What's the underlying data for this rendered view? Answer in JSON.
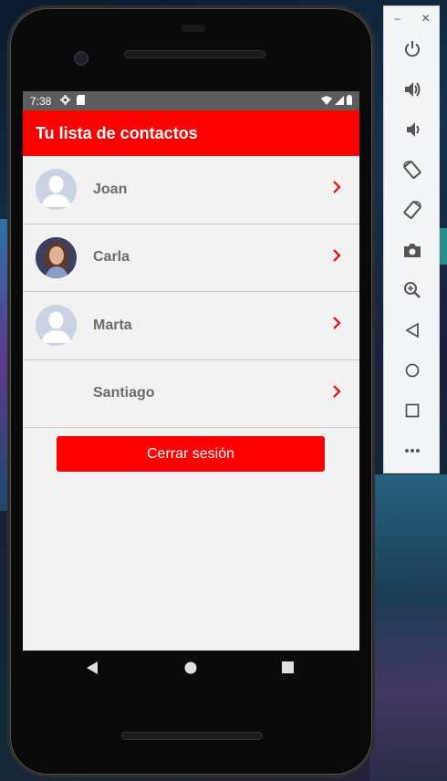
{
  "status_bar": {
    "time": "7:38"
  },
  "app_bar": {
    "title": "Tu lista de contactos"
  },
  "contacts": [
    {
      "name": "Joan",
      "avatar": "default-avatar"
    },
    {
      "name": "Carla",
      "avatar": "photo-avatar"
    },
    {
      "name": "Marta",
      "avatar": "default-avatar"
    },
    {
      "name": "Santiago",
      "avatar": "none"
    }
  ],
  "logout_button": {
    "label": "Cerrar sesión"
  },
  "colors": {
    "accent": "#ff0000",
    "status_bar": "#5d5d5d",
    "background": "#f2f2f2",
    "name_text": "#6b6b6b"
  },
  "emulator_toolbar": {
    "window_controls": [
      "minimize-icon",
      "close-icon"
    ],
    "buttons": [
      "power-icon",
      "volume-up-icon",
      "volume-down-icon",
      "rotate-left-icon",
      "rotate-right-icon",
      "camera-icon",
      "zoom-icon",
      "back-icon",
      "home-icon",
      "overview-icon",
      "more-icon"
    ]
  }
}
